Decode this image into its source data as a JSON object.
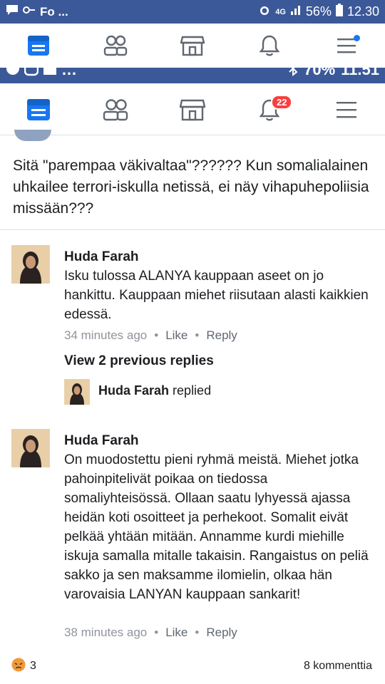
{
  "status_bar": {
    "app_label": "Fo ...",
    "network": "4G",
    "battery": "56%",
    "time": "12.30"
  },
  "overlay_strip": {
    "battery": "70%",
    "time": "11.51"
  },
  "nav_badge_count": "22",
  "post": {
    "text": "Sitä \"parempaa väkivaltaa\"?????? Kun somalialainen uhkailee terrori-iskulla netissä, ei näy vihapuhepoliisia missään???"
  },
  "comments": [
    {
      "name": "Huda Farah",
      "text": "Isku tulossa ALANYA kauppaan aseet on jo hankittu. Kauppaan miehet riisutaan alasti kaikkien edessä.",
      "time": "34 minutes ago",
      "like": "Like",
      "reply": "Reply"
    },
    {
      "name": "Huda Farah",
      "text": "On muodostettu pieni ryhmä meistä. Miehet jotka pahoinpitelivät poikaa on tiedossa somaliyhteisössä. Ollaan saatu lyhyessä ajassa heidän koti osoitteet ja perhekoot. Somalit eivät pelkää yhtään mitään. Annamme kurdi miehille iskuja samalla mitalle takaisin. Rangaistus on peliä sakko ja sen maksamme ilomielin, olkaa hän varovaisia LANYAN kauppaan sankarit!",
      "time": "38 minutes ago",
      "like": "Like",
      "reply": "Reply"
    }
  ],
  "view_previous": "View 2 previous replies",
  "replied_line": {
    "name": "Huda Farah",
    "action": "replied"
  },
  "footer": {
    "reaction_count": "3",
    "comments_count": "8 kommenttia"
  },
  "colors": {
    "facebook_blue": "#3b5998",
    "badge_red": "#fa3e3e",
    "link_blue": "#1877f2"
  }
}
